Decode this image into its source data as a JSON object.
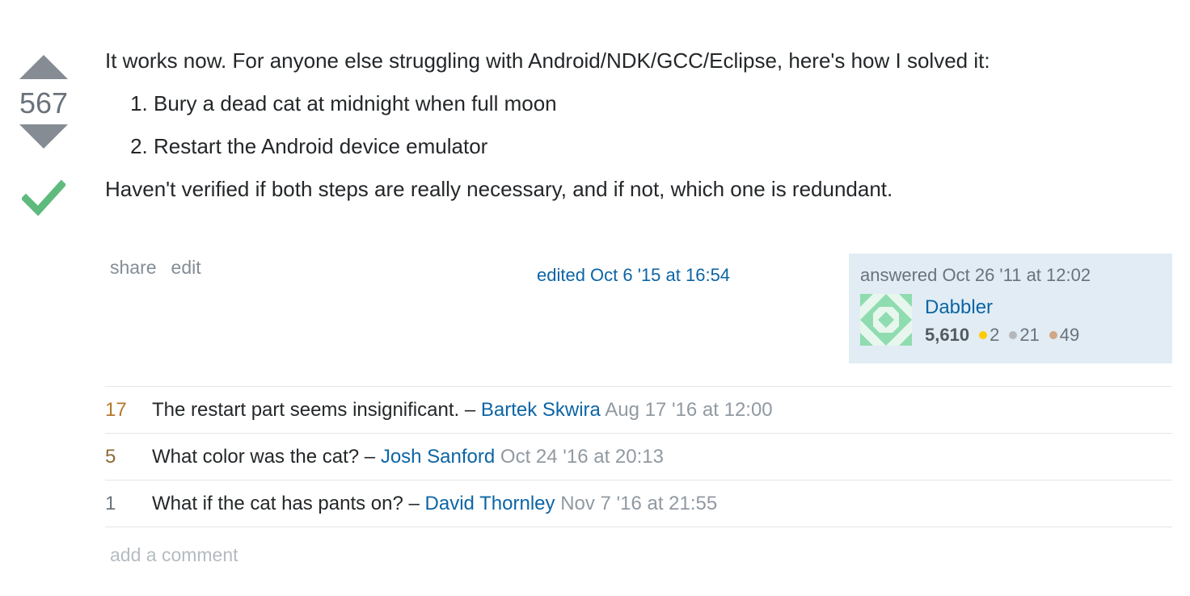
{
  "colors": {
    "link": "#0C65A5",
    "muted": "#6a737c",
    "accepted": "#5EBA7D",
    "owner_card_bg": "#E1ECF4",
    "gold": "#FFCC01",
    "silver": "#B4B8BC",
    "bronze": "#D1A684",
    "score_bronze": "#B67729",
    "score_dark": "#8D6B36",
    "score_plain": "#6a737c"
  },
  "vote": {
    "count": "567",
    "up_icon": "arrow-up-icon",
    "down_icon": "arrow-down-icon",
    "accepted_icon": "checkmark-icon"
  },
  "post": {
    "intro": "It works now. For anyone else struggling with Android/NDK/GCC/Eclipse, here's how I solved it:",
    "steps": [
      "Bury a dead cat at midnight when full moon",
      "Restart the Android device emulator"
    ],
    "outro": "Haven't verified if both steps are really necessary, and if not, which one is redundant."
  },
  "menu": {
    "share": "share",
    "edit": "edit"
  },
  "edited": "edited Oct 6 '15 at 16:54",
  "owner": {
    "action_time": "answered Oct 26 '11 at 12:02",
    "name": "Dabbler",
    "reputation": "5,610",
    "gold": "2",
    "silver": "21",
    "bronze": "49"
  },
  "comments": [
    {
      "score": "17",
      "text": "The restart part seems insignificant. –",
      "user": "Bartek Skwira",
      "date": "Aug 17 '16 at 12:00"
    },
    {
      "score": "5",
      "text": "What color was the cat? –",
      "user": "Josh Sanford",
      "date": "Oct 24 '16 at 20:13"
    },
    {
      "score": "1",
      "text": "What if the cat has pants on? –",
      "user": "David Thornley",
      "date": "Nov 7 '16 at 21:55"
    }
  ],
  "add_comment": "add a comment"
}
